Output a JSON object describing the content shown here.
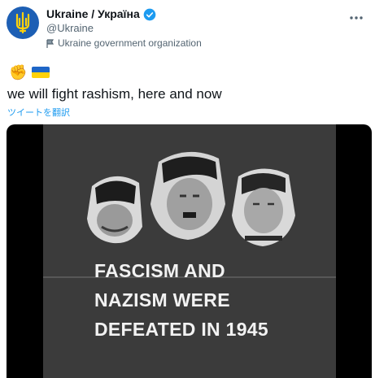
{
  "account": {
    "display_name": "Ukraine / Україна",
    "handle": "@Ukraine",
    "label": "Ukraine government organization"
  },
  "tweet": {
    "text": "we will fight rashism, here and now",
    "translate_label": "ツイートを翻訳",
    "emojis": [
      "raised-fist",
      "ukraine-flag"
    ]
  },
  "media": {
    "headline_lines": [
      "FASCISM AND",
      "NAZISM WERE",
      "DEFEATED IN 1945"
    ]
  },
  "colors": {
    "verified": "#1d9bf0",
    "link": "#1d9bf0",
    "avatar_bg": "#1d5fb4",
    "trident": "#ffd10a",
    "flag_blue": "#1e66c7",
    "flag_yellow": "#ffd10a"
  }
}
